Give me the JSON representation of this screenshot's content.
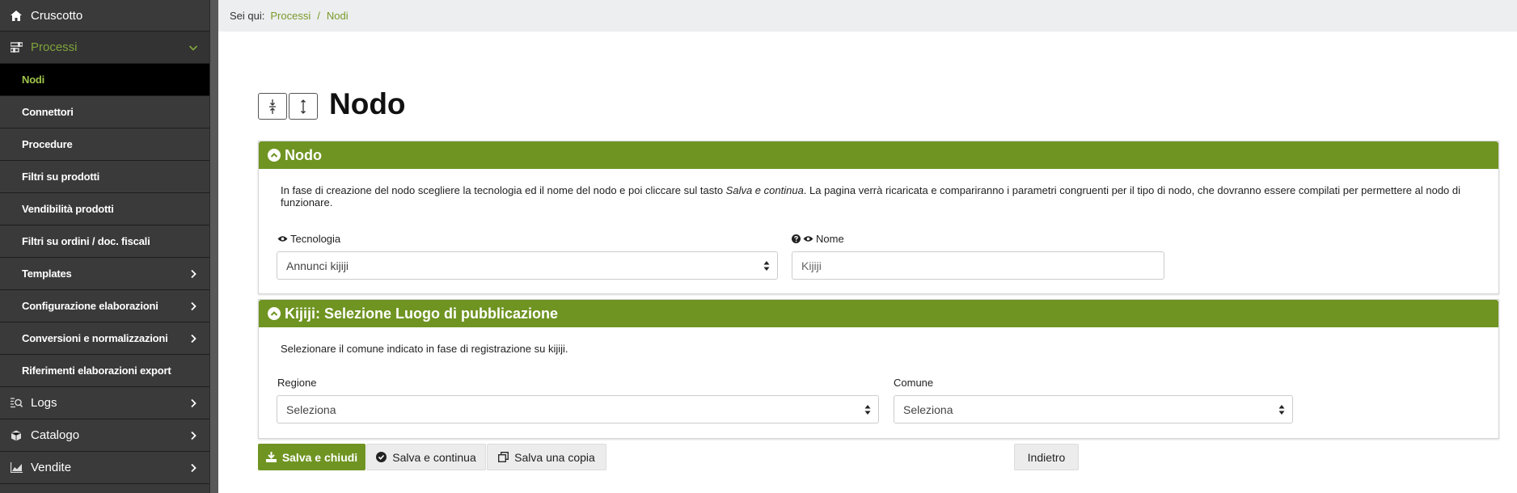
{
  "sidebar": {
    "items": [
      {
        "label": "Cruscotto",
        "icon": "home-icon"
      },
      {
        "label": "Processi",
        "icon": "sliders-icon"
      },
      {
        "label": "Nodi"
      },
      {
        "label": "Connettori"
      },
      {
        "label": "Procedure"
      },
      {
        "label": "Filtri su prodotti"
      },
      {
        "label": "Vendibilità prodotti"
      },
      {
        "label": "Filtri su ordini / doc. fiscali"
      },
      {
        "label": "Templates"
      },
      {
        "label": "Configurazione elaborazioni"
      },
      {
        "label": "Conversioni e normalizzazioni"
      },
      {
        "label": "Riferimenti elaborazioni export"
      },
      {
        "label": "Logs",
        "icon": "log-search-icon"
      },
      {
        "label": "Catalogo",
        "icon": "cube-icon"
      },
      {
        "label": "Vendite",
        "icon": "chart-area-icon"
      }
    ]
  },
  "breadcrumb": {
    "prefix": "Sei qui:",
    "items": [
      "Processi",
      "Nodi"
    ],
    "separator": "/"
  },
  "page": {
    "title": "Nodo"
  },
  "panel_nodo": {
    "title": "Nodo",
    "desc_before": "In fase di creazione del nodo scegliere la tecnologia ed il nome del nodo e poi cliccare sul tasto ",
    "desc_em": "Salva e continua",
    "desc_after": ". La pagina verrà ricaricata e compariranno i parametri congruenti per il tipo di nodo, che dovranno essere compilati per permettere al nodo di funzionare.",
    "tecnologia_label": "Tecnologia",
    "tecnologia_value": "Annunci kijiji",
    "nome_label": "Nome",
    "nome_placeholder": "Kijiji"
  },
  "panel_luogo": {
    "title": "Kijiji: Selezione Luogo di pubblicazione",
    "desc": "Selezionare il comune indicato in fase di registrazione su kijiji.",
    "regione_label": "Regione",
    "regione_value": "Seleziona",
    "comune_label": "Comune",
    "comune_value": "Seleziona"
  },
  "buttons": {
    "save_close": "Salva e chiudi",
    "save_continue": "Salva e continua",
    "save_copy": "Salva una copia",
    "back": "Indietro"
  },
  "colors": {
    "accent": "#6f9422",
    "link": "#7a9a2a",
    "sidebar_bg": "#3a3a3a",
    "active_text": "#9ec54a"
  }
}
